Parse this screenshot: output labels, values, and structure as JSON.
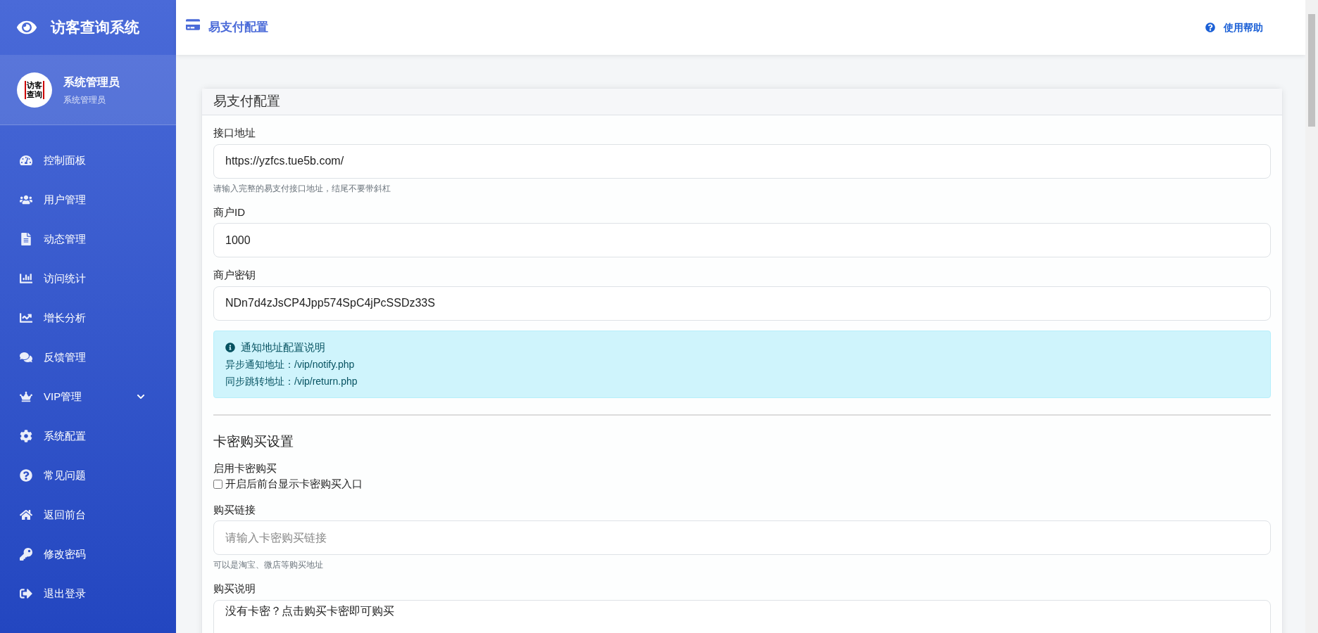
{
  "brand": {
    "title": "访客查询系统"
  },
  "user": {
    "avatar_text": "访客查询",
    "name": "系统管理员",
    "role": "系统管理员"
  },
  "sidebar": {
    "items": [
      {
        "label": "控制面板"
      },
      {
        "label": "用户管理"
      },
      {
        "label": "动态管理"
      },
      {
        "label": "访问统计"
      },
      {
        "label": "增长分析"
      },
      {
        "label": "反馈管理"
      },
      {
        "label": "VIP管理",
        "expanded": false
      },
      {
        "label": "系统配置"
      },
      {
        "label": "常见问题"
      },
      {
        "label": "返回前台"
      },
      {
        "label": "修改密码"
      },
      {
        "label": "退出登录"
      }
    ]
  },
  "header": {
    "title": "易支付配置",
    "help": "使用帮助"
  },
  "card": {
    "title": "易支付配置",
    "fields": [
      {
        "label": "接口地址",
        "value": "https://yzfcs.tue5b.com/",
        "hint": "请输入完整的易支付接口地址，结尾不要带斜杠"
      },
      {
        "label": "商户ID",
        "value": "1000"
      },
      {
        "label": "商户密钥",
        "value": "NDn7d4zJsCP4Jpp574SpC4jPcSSDz33S"
      }
    ],
    "alert": {
      "title": "通知地址配置说明",
      "lines": [
        "异步通知地址：/vip/notify.php",
        "同步跳转地址：/vip/return.php"
      ]
    },
    "section": {
      "title": "卡密购买设置",
      "toggle": {
        "label": "启用卡密购买",
        "text": "开启后前台显示卡密购买入口",
        "checked": false
      },
      "link": {
        "label": "购买链接",
        "placeholder": "请输入卡密购买链接",
        "hint": "可以是淘宝、微店等购买地址"
      },
      "description": {
        "label": "购买说明",
        "value": "没有卡密？点击购买卡密即可购买"
      }
    }
  }
}
